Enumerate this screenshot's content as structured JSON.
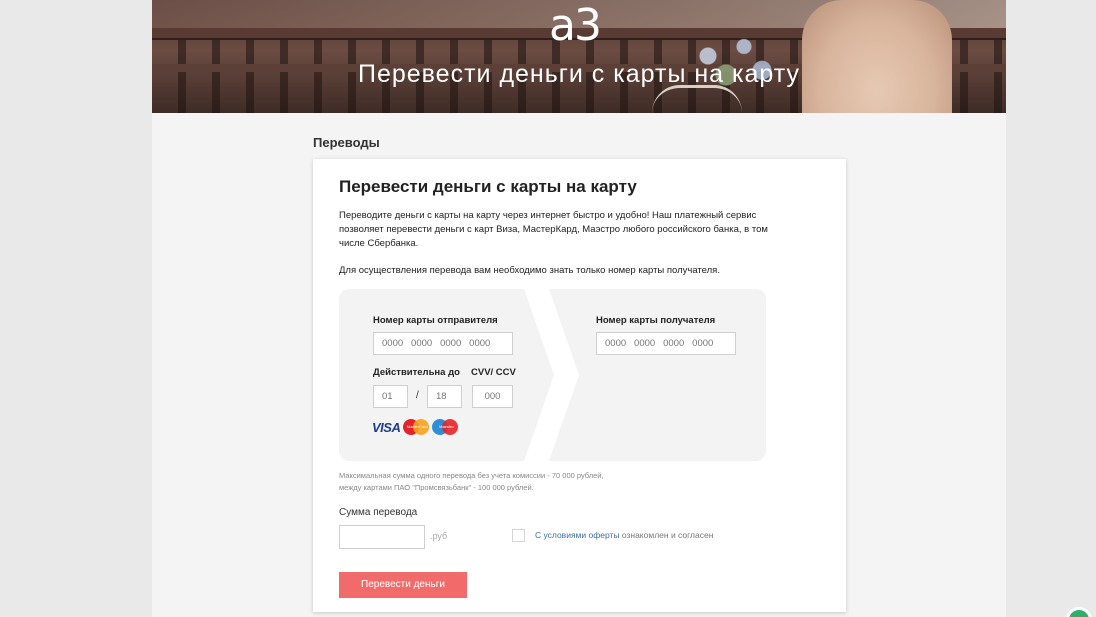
{
  "hero": {
    "logo": "a3",
    "title": "Перевести деньги с карты на карту"
  },
  "section": {
    "title": "Переводы"
  },
  "card": {
    "heading": "Перевести деньги с карты на карту",
    "description": "Переводите деньги с карты на карту через интернет быстро и удобно! Наш платежный сервис позволяет перевести деньги с карт Виза, МастерКард, Маэстро любого российского банка, в том числе Сбербанка.",
    "note": "Для осуществления перевода вам необходимо знать только номер карты получателя."
  },
  "sender": {
    "label": "Номер карты отправителя",
    "card_placeholder": "0000   0000   0000   0000",
    "expiry_label": "Действительна до",
    "month_placeholder": "01",
    "separator": "/",
    "year_placeholder": "18",
    "cvv_label": "CVV/ CCV",
    "cvv_placeholder": "000"
  },
  "recipient": {
    "label": "Номер карты получателя",
    "card_placeholder": "0000   0000   0000   0000"
  },
  "payment_logos": {
    "visa": "VISA",
    "mastercard": "MasterCard",
    "maestro": "Maestro"
  },
  "limits": {
    "line1": "Максимальная сумма одного перевода без учета комиссии - 70 000 рублей,",
    "line2": "между картами ПАО \"Промсвязьбанк\" - 100 000 рублей."
  },
  "amount": {
    "label": "Сумма перевода",
    "value": "",
    "currency": ".руб"
  },
  "agreement": {
    "link_text": "С условиями оферты",
    "text": " ознакомлен и согласен",
    "checked": false
  },
  "submit": {
    "label": "Перевести деньги"
  },
  "colors": {
    "accent_button": "#f26b6b",
    "link": "#3d6fa8",
    "badge": "#2fb06a"
  }
}
